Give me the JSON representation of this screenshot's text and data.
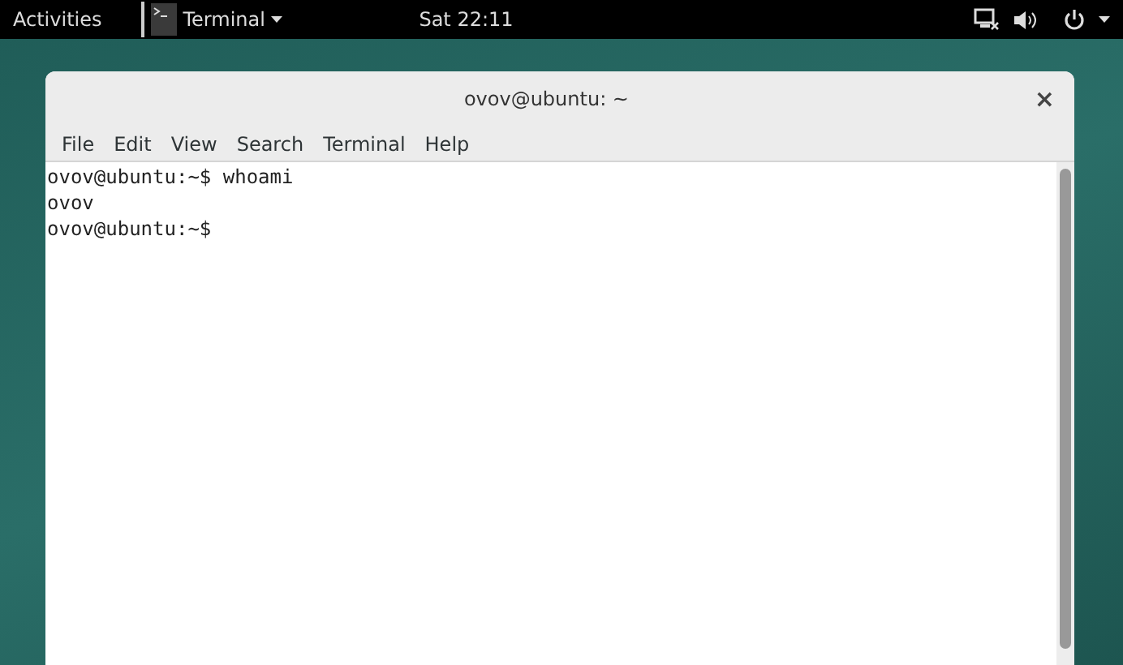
{
  "top_bar": {
    "activities": "Activities",
    "app_menu": "Terminal",
    "clock": "Sat 22:11"
  },
  "window": {
    "title": "ovov@ubuntu: ~",
    "close": "×"
  },
  "menu": [
    "File",
    "Edit",
    "View",
    "Search",
    "Terminal",
    "Help"
  ],
  "terminal_lines": [
    "ovov@ubuntu:~$ whoami",
    "ovov",
    "ovov@ubuntu:~$"
  ]
}
